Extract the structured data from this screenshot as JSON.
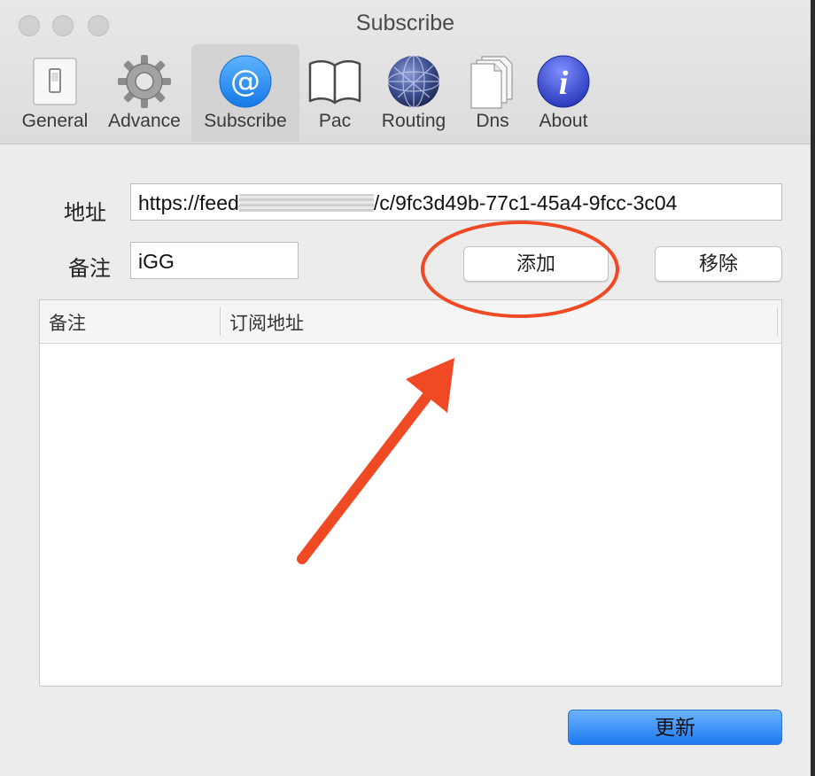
{
  "window": {
    "title": "Subscribe"
  },
  "toolbar": {
    "tabs": [
      {
        "label": "General",
        "icon": "switch-icon"
      },
      {
        "label": "Advance",
        "icon": "gear-icon"
      },
      {
        "label": "Subscribe",
        "icon": "at-sign-icon",
        "selected": true
      },
      {
        "label": "Pac",
        "icon": "book-icon"
      },
      {
        "label": "Routing",
        "icon": "globe-icon"
      },
      {
        "label": "Dns",
        "icon": "documents-icon"
      },
      {
        "label": "About",
        "icon": "info-icon"
      }
    ]
  },
  "form": {
    "address_label": "地址",
    "address_prefix": "https://feed",
    "address_suffix": "/c/9fc3d49b-77c1-45a4-9fcc-3c04",
    "remark_label": "备注",
    "remark_value": "iGG",
    "add_button": "添加",
    "remove_button": "移除"
  },
  "table": {
    "columns": [
      "备注",
      "订阅地址"
    ],
    "rows": []
  },
  "footer": {
    "update_button": "更新"
  },
  "colors": {
    "annotation_red": "#f04a24",
    "primary_blue": "#1d7af2"
  }
}
